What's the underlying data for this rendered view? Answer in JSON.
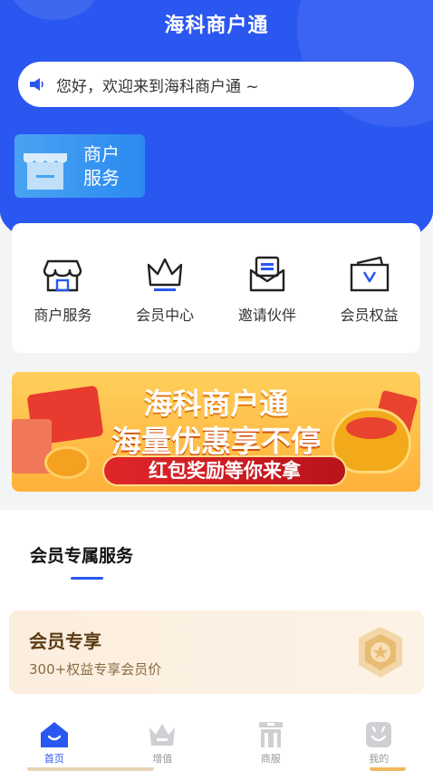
{
  "header": {
    "title": "海科商户通"
  },
  "notice": {
    "text": "您好，欢迎来到海科商户通 ~",
    "icon": "speaker-icon"
  },
  "merchant_tile": {
    "line1": "商户",
    "line2": "服务",
    "icon": "shop-icon"
  },
  "quick_actions": [
    {
      "label": "商户服务",
      "icon": "store-icon"
    },
    {
      "label": "会员中心",
      "icon": "crown-icon"
    },
    {
      "label": "邀请伙伴",
      "icon": "envelope-icon"
    },
    {
      "label": "会员权益",
      "icon": "wallet-icon"
    }
  ],
  "banner": {
    "title": "海科商户通",
    "subtitle": "海量优惠享不停",
    "pill": "红包奖励等你来拿"
  },
  "section": {
    "title": "会员专属服务",
    "vip": {
      "title": "会员专享",
      "subtitle": "300+权益专享会员价",
      "icon": "medal-icon"
    }
  },
  "tabbar": [
    {
      "label": "首页",
      "icon": "home-icon",
      "active": true
    },
    {
      "label": "增值",
      "icon": "crown-icon",
      "active": false
    },
    {
      "label": "商服",
      "icon": "building-icon",
      "active": false
    },
    {
      "label": "我的",
      "icon": "smiley-icon",
      "active": false
    }
  ],
  "colors": {
    "primary": "#2a57f0",
    "accent": "#f2a91a"
  }
}
